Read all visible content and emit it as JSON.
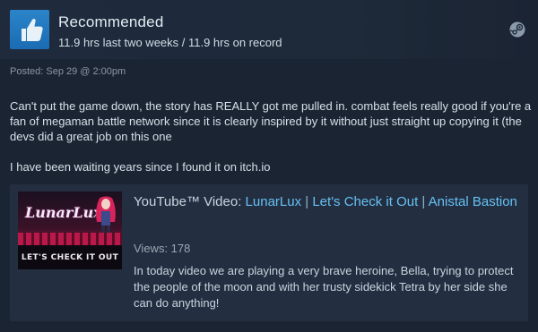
{
  "review": {
    "recommendation": "Recommended",
    "hours": "11.9 hrs last two weeks / 11.9 hrs on record",
    "posted": "Posted: Sep 29 @ 2:00pm",
    "paragraphs": [
      "Can't put the game down, the story has REALLY got me pulled in. combat feels really good if you're a fan of megaman battle network since it is clearly inspired by it without just straight up copying it (the devs did a great job on this one",
      "I have been waiting years since I found it on itch.io"
    ],
    "icons": {
      "thumb": "thumbs-up-icon",
      "platform": "steam-icon"
    },
    "colors": {
      "thumb_bg": "#1a6cb3",
      "link": "#66c0f4",
      "background": "#1b2433"
    }
  },
  "embed": {
    "prefix": "YouTube™ Video: ",
    "channel": "LunarLux",
    "separator": " | ",
    "part1": "Let's Check it Out",
    "part2": "Anistal Bastion",
    "views": "Views: 178",
    "description": "In today video we are playing a very brave heroine, Bella, trying to protect the people of the moon and with her trusty sidekick Tetra by her side she can do anything!",
    "thumbnail": {
      "logo": "LunarLux",
      "banner": "LET'S CHECK IT OUT"
    }
  }
}
